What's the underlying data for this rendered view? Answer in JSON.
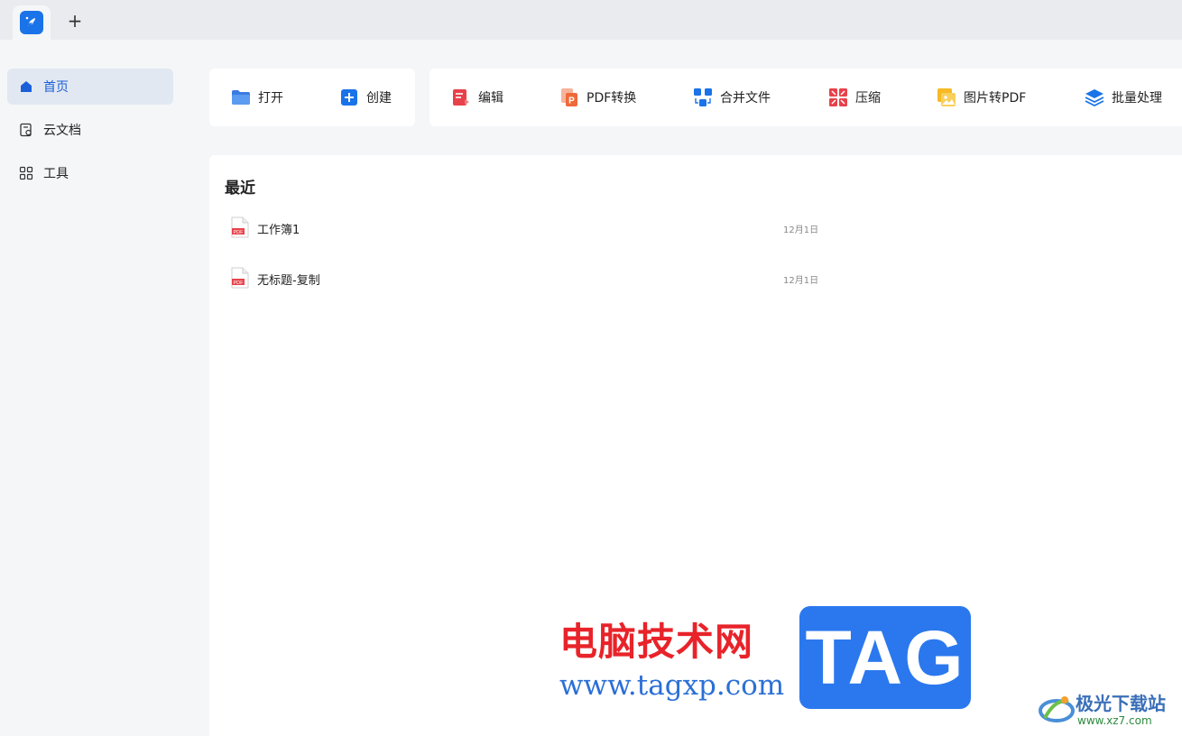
{
  "tabbar": {
    "new_tab_symbol": "+",
    "app_icon": "app-logo-icon"
  },
  "sidebar": {
    "items": [
      {
        "label": "首页",
        "icon": "home-icon",
        "active": true
      },
      {
        "label": "云文档",
        "icon": "cloud-doc-icon",
        "active": false
      },
      {
        "label": "工具",
        "icon": "tools-grid-icon",
        "active": false
      }
    ]
  },
  "toolbar": {
    "open_label": "打开",
    "create_label": "创建",
    "edit_label": "编辑",
    "pdf_convert_label": "PDF转换",
    "merge_label": "合并文件",
    "compress_label": "压缩",
    "image_to_pdf_label": "图片转PDF",
    "batch_label": "批量处理"
  },
  "recent": {
    "title": "最近",
    "files": [
      {
        "name": "工作簿1",
        "date": "12月1日",
        "icon": "pdf-file-icon"
      },
      {
        "name": "无标题-复制",
        "date": "12月1日",
        "icon": "pdf-file-icon"
      }
    ]
  },
  "watermark": {
    "cn_text": "电脑技术网",
    "url": "www.tagxp.com",
    "tag": "TAG",
    "site_name": "极光下载站",
    "site_url": "www.xz7.com"
  },
  "colors": {
    "accent": "#1a73e8",
    "sidebar_active_bg": "#e2e8f2",
    "watermark_red": "#e8232a",
    "watermark_blue": "#2b78ee"
  }
}
